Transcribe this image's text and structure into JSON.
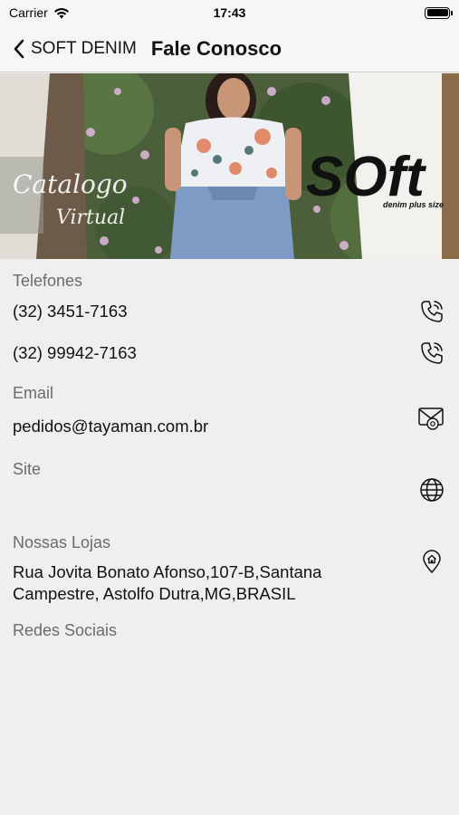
{
  "status_bar": {
    "carrier": "Carrier",
    "time": "17:43"
  },
  "nav": {
    "back_label": "SOFT DENIM",
    "title": "Fale Conosco"
  },
  "banner": {
    "brand": "SOft",
    "tagline": "denim plus size",
    "catalog_line1": "Catalogo",
    "catalog_line2": "Virtual"
  },
  "contact": {
    "phones_label": "Telefones",
    "phone1": "(32) 3451-7163",
    "phone2": "(32) 99942-7163",
    "email_label": "Email",
    "email": "pedidos@tayaman.com.br",
    "site_label": "Site",
    "stores_label": "Nossas Lojas",
    "address_line1": "Rua Jovita Bonato Afonso,107-B,Santana",
    "address_line2": "Campestre, Astolfo Dutra,MG,BRASIL",
    "social_label": "Redes Sociais"
  },
  "icons": {
    "phone1": "phone-call-icon",
    "phone2": "phone-call-icon",
    "email": "envelope-at-icon",
    "site": "globe-icon",
    "store": "home-location-pin-icon"
  }
}
